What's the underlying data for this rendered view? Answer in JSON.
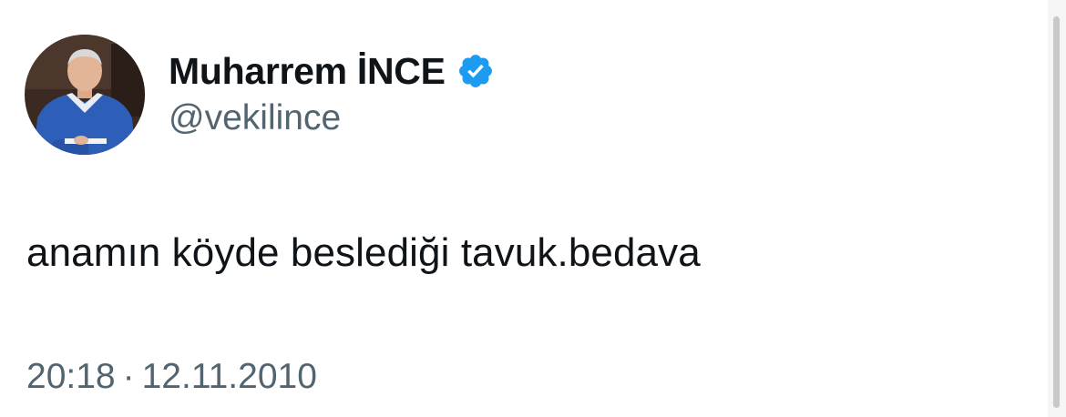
{
  "tweet": {
    "author": {
      "display_name": "Muharrem İNCE",
      "handle": "@vekilince",
      "verified": true,
      "avatar_icon": "profile-photo"
    },
    "text": "anamın köyde beslediği tavuk.bedava",
    "time": "20:18",
    "separator": "·",
    "date": "12.11.2010"
  },
  "colors": {
    "verified_badge": "#1d9bf0",
    "text_primary": "#0f1419",
    "text_secondary": "#536471"
  }
}
